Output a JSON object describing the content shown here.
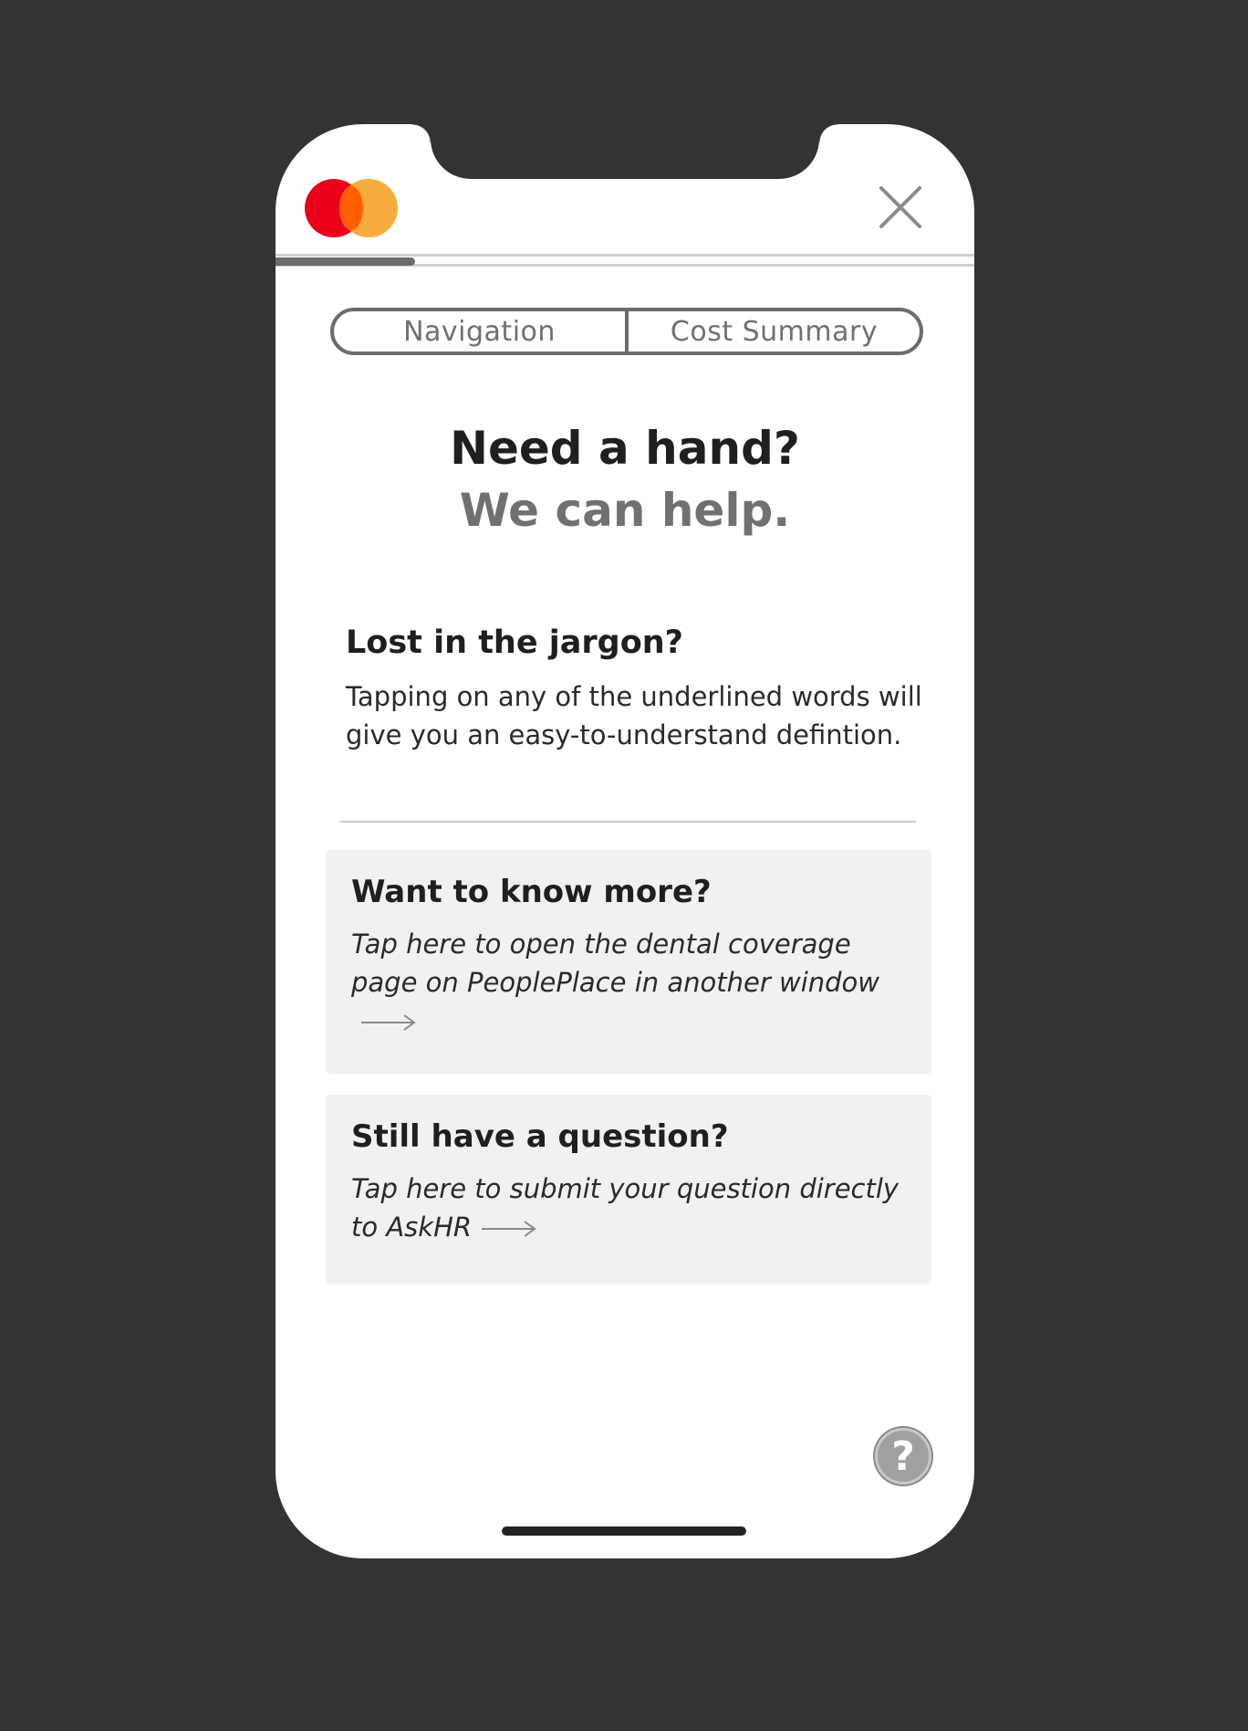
{
  "header": {
    "logo_icon": "mastercard-logo-icon",
    "close_icon": "close-icon",
    "progress_fraction": 0.2
  },
  "tabs": [
    {
      "label": "Navigation"
    },
    {
      "label": "Cost Summary"
    }
  ],
  "hero": {
    "title": "Need a hand?",
    "subtitle": "We can help."
  },
  "jargon": {
    "title": "Lost in the jargon?",
    "text": "Tapping on any of the underlined words will give you an easy-to-understand defintion."
  },
  "cards": [
    {
      "title": "Want to know more?",
      "text": "Tap here to open the dental coverage page on PeoplePlace in another window",
      "icon": "arrow-right-icon"
    },
    {
      "title": "Still have a question?",
      "text": "Tap here to submit your question directly to AskHR",
      "icon": "arrow-right-icon"
    }
  ],
  "help_button": {
    "label": "?",
    "icon": "help-icon"
  },
  "colors": {
    "background": "#333333",
    "mastercard_red": "#eb001b",
    "mastercard_orange": "#f79e1b",
    "card_background": "#f1f1f1"
  }
}
